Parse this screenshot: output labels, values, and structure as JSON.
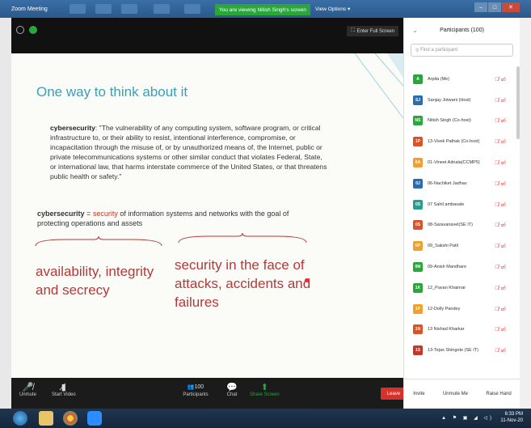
{
  "window": {
    "title": "Zoom Meeting",
    "viewing_banner": "You are viewing Nitish Singh's screen",
    "view_options": "View Options",
    "close": "✕",
    "minimize": "–",
    "maximize": "□"
  },
  "video": {
    "fullscreen_label": "Enter Full Screen"
  },
  "slide": {
    "title": "One way to think about it",
    "quote_term": "cybersecurity",
    "quote_body": ": \"The vulnerability of any computing system, software program, or critical infrastructure to, or their ability to resist, intentional interference, compromise, or incapacitation through the misuse of, or by unauthorized means of, the Internet, public or private telecommunications systems or other similar conduct that violates Federal, State, or international law, that harms interstate commerce of the United States, or that threatens public health or safety.\"",
    "def_term": "cybersecurity",
    "def_eq": " = ",
    "def_security": "security",
    "def_rest": " of information systems and networks with the goal of protecting operations and assets",
    "left_big_line1": "availability, integrity",
    "left_big_line2": "and secrecy",
    "right_big": "security in the face of attacks, accidents and failures"
  },
  "toolbar": {
    "unmute": "Unmute",
    "start_video": "Start Video",
    "participants": "Participants",
    "participants_count": "100",
    "chat": "Chat",
    "share_screen": "Share Screen",
    "leave": "Leave"
  },
  "panel": {
    "title": "Participants (100)",
    "search_placeholder": "Find a participant",
    "invite": "Invite",
    "unmute_me": "Unmute Me",
    "raise_hand": "Raise Hand",
    "participants": [
      {
        "initials": "A",
        "name": "Arpita (Me)",
        "color": "#2aa63b"
      },
      {
        "initials": "SJ",
        "name": "Sanjay Jotwani (Host)",
        "color": "#2b6cb0"
      },
      {
        "initials": "NS",
        "name": "Nitish Singh (Co-host)",
        "color": "#2aa63b"
      },
      {
        "initials": "1P",
        "name": "13-Vivek Pathak (Co-host)",
        "color": "#d9532c"
      },
      {
        "initials": "0A",
        "name": "01-Vineet Adnala(CCMP5)",
        "color": "#f0a030"
      },
      {
        "initials": "0J",
        "name": "06-Nachiket Jadhav",
        "color": "#2b6cb0"
      },
      {
        "initials": "0S",
        "name": "07 Sahil ambavale",
        "color": "#2a9d8f"
      },
      {
        "initials": "0S",
        "name": "08-Saravanavel(SE IT)",
        "color": "#d9532c"
      },
      {
        "initials": "0P",
        "name": "09_Sakshi Patil",
        "color": "#f0a030"
      },
      {
        "initials": "0M",
        "name": "09-Anish Mandhare",
        "color": "#2aa63b"
      },
      {
        "initials": "1K",
        "name": "12_Pavan Khairnar",
        "color": "#2aa63b"
      },
      {
        "initials": "1P",
        "name": "12-Dolly Pandey",
        "color": "#f0a030"
      },
      {
        "initials": "1N",
        "name": "13 Nishad Kharkar",
        "color": "#d9532c"
      },
      {
        "initials": "1S",
        "name": "13-Tejas Shingote (SE IT)",
        "color": "#c0392b"
      }
    ]
  },
  "taskbar": {
    "time": "6:33 PM",
    "date": "11-Nov-20"
  }
}
